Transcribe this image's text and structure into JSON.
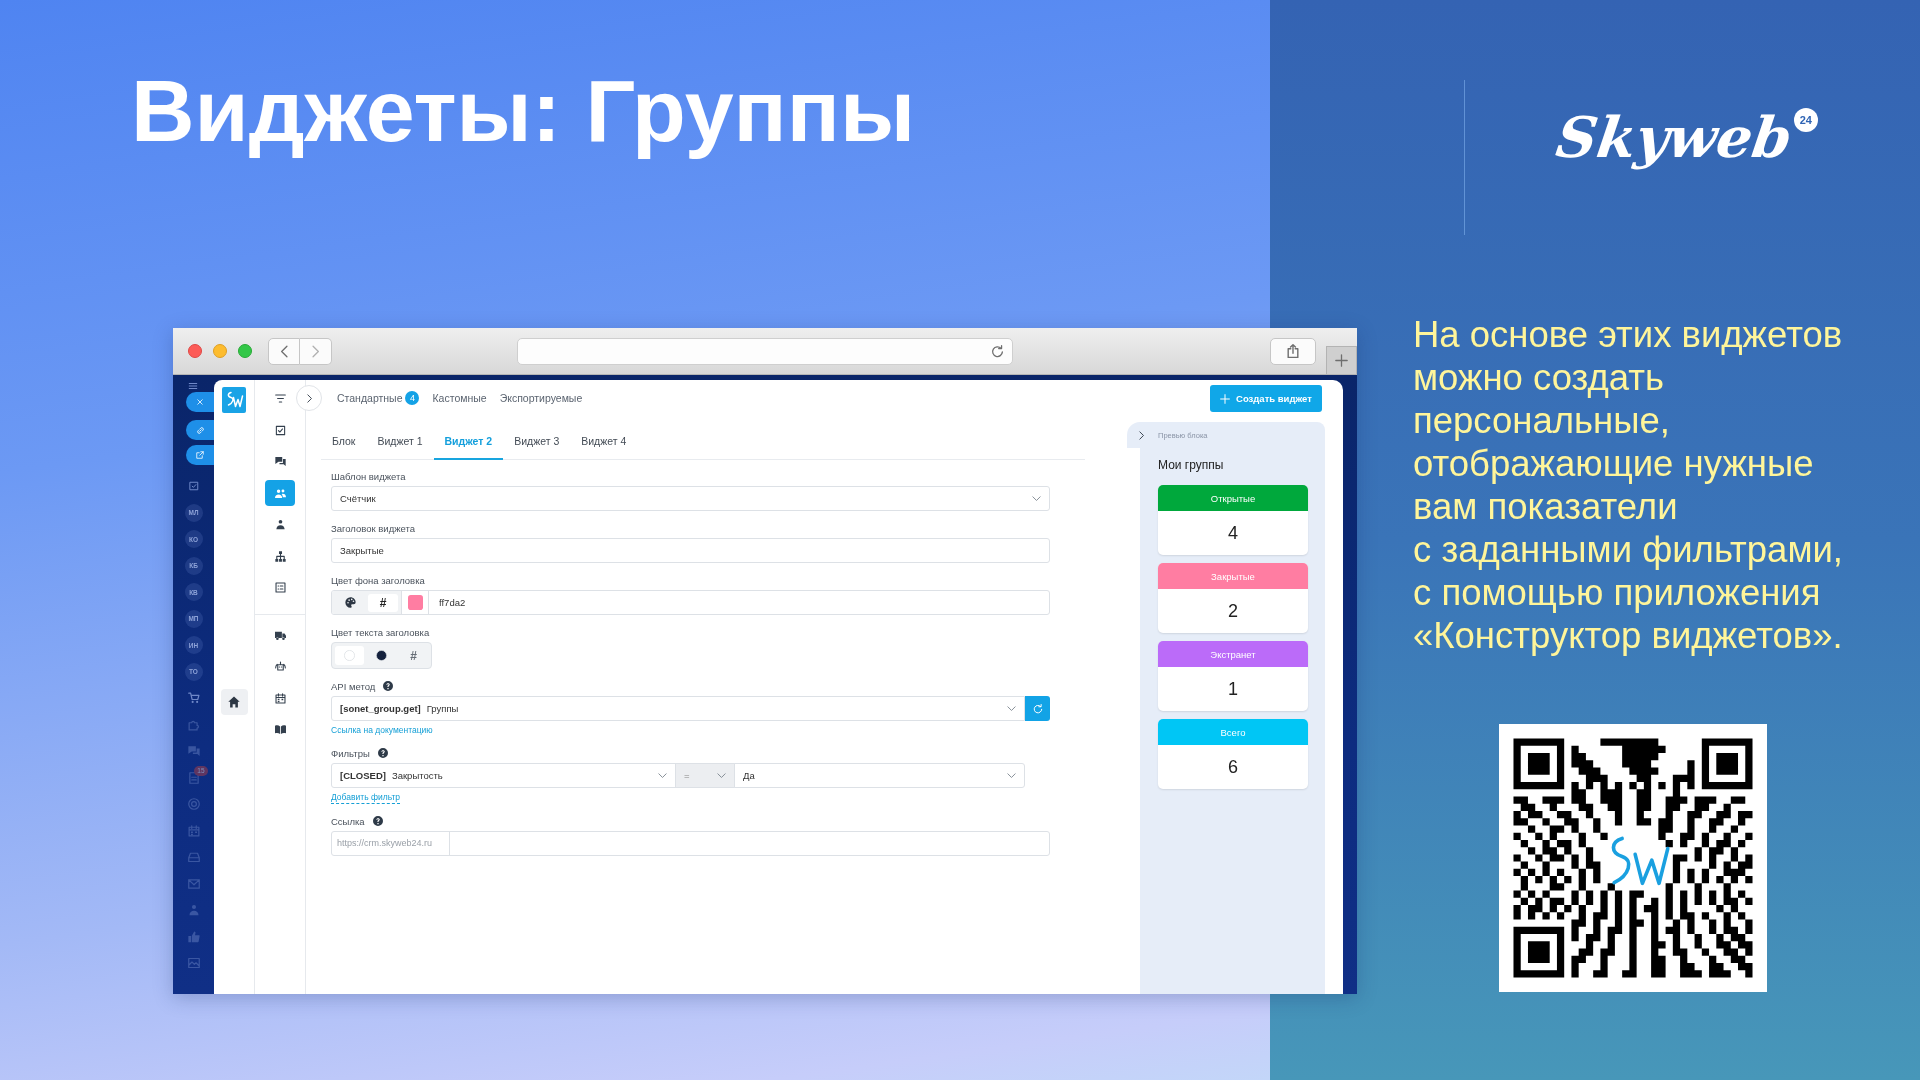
{
  "title": "Виджеты: Группы",
  "logo": {
    "name": "Skyweb",
    "badge": "24"
  },
  "description": [
    "На основе этих виджетов",
    "можно создать",
    "персональные,",
    "отображающие нужные",
    "вам показатели",
    "с заданными фильтрами,",
    "с помощью приложения",
    "«Конструктор виджетов»."
  ],
  "browser": {
    "left_menu": {
      "avatars": [
        "МЛ",
        "КО",
        "КБ",
        "КВ",
        "МП",
        "ИН",
        "ТО"
      ],
      "badge": "15"
    },
    "app": {
      "home": {
        "selected": true
      },
      "nav": [
        {
          "selected": false
        },
        {
          "selected": false
        },
        {
          "selected": false
        },
        {
          "selected": true
        },
        {
          "selected": false
        },
        {
          "selected": false
        },
        {
          "selected": false
        }
      ],
      "nav_lower": [
        {
          "selected": false
        },
        {
          "selected": false
        },
        {
          "selected": false
        },
        {
          "selected": false
        }
      ],
      "category_tabs": [
        {
          "label": "Стандартные",
          "badge": "4",
          "selected": false
        },
        {
          "label": "Кастомные",
          "selected": false
        },
        {
          "label": "Экспортируемые",
          "selected": false
        }
      ],
      "create_button": "Создать виджет",
      "widget_tabs": [
        {
          "label": "Блок",
          "selected": false
        },
        {
          "label": "Виджет 1",
          "selected": false
        },
        {
          "label": "Виджет 2",
          "selected": true
        },
        {
          "label": "Виджет 3",
          "selected": false
        },
        {
          "label": "Виджет 4",
          "selected": false
        }
      ],
      "fields": [
        {
          "kind": "select",
          "label": "Шаблон виджета",
          "value": "Счётчик"
        },
        {
          "kind": "text",
          "label": "Заголовок виджета",
          "value": "Закрытые"
        },
        {
          "kind": "color",
          "label": "Цвет фона заголовка",
          "modes": [
            {
              "kind": "palette",
              "selected": false
            },
            {
              "kind": "hex",
              "label": "#",
              "selected": true
            }
          ],
          "color": "#ff7da2",
          "value": "ff7da2"
        },
        {
          "kind": "swatches",
          "label": "Цвет текста заголовка",
          "options": [
            {
              "kind": "color",
              "color": "#ffffff",
              "selected": true
            },
            {
              "kind": "color",
              "color": "#14213d",
              "selected": false
            },
            {
              "kind": "hex",
              "label": "#",
              "selected": false
            }
          ]
        },
        {
          "kind": "method",
          "label": "API метод",
          "help": true,
          "code": "[sonet_group.get]",
          "value": "Группы",
          "link": "Ссылка на документацию"
        },
        {
          "kind": "filters",
          "label": "Фильтры",
          "help": true,
          "filters": [
            {
              "code": "[CLOSED]",
              "value": "Закрытость",
              "operator": "=",
              "operand": "Да"
            }
          ],
          "link": "Добавить фильтр"
        },
        {
          "kind": "prefixed",
          "label": "Ссылка",
          "help": true,
          "prefix": "https://crm.skyweb24.ru"
        }
      ],
      "preview": {
        "title": "Превью блока",
        "block_title": "Мои группы",
        "widgets": [
          {
            "title": "Открытые",
            "value": "4",
            "color": "#00a83c"
          },
          {
            "title": "Закрытые",
            "value": "2",
            "color": "#ff7da2"
          },
          {
            "title": "Экстранет",
            "value": "1",
            "color": "#bb6bf9"
          },
          {
            "title": "Всего",
            "value": "6",
            "color": "#00c6f5"
          }
        ]
      }
    }
  }
}
